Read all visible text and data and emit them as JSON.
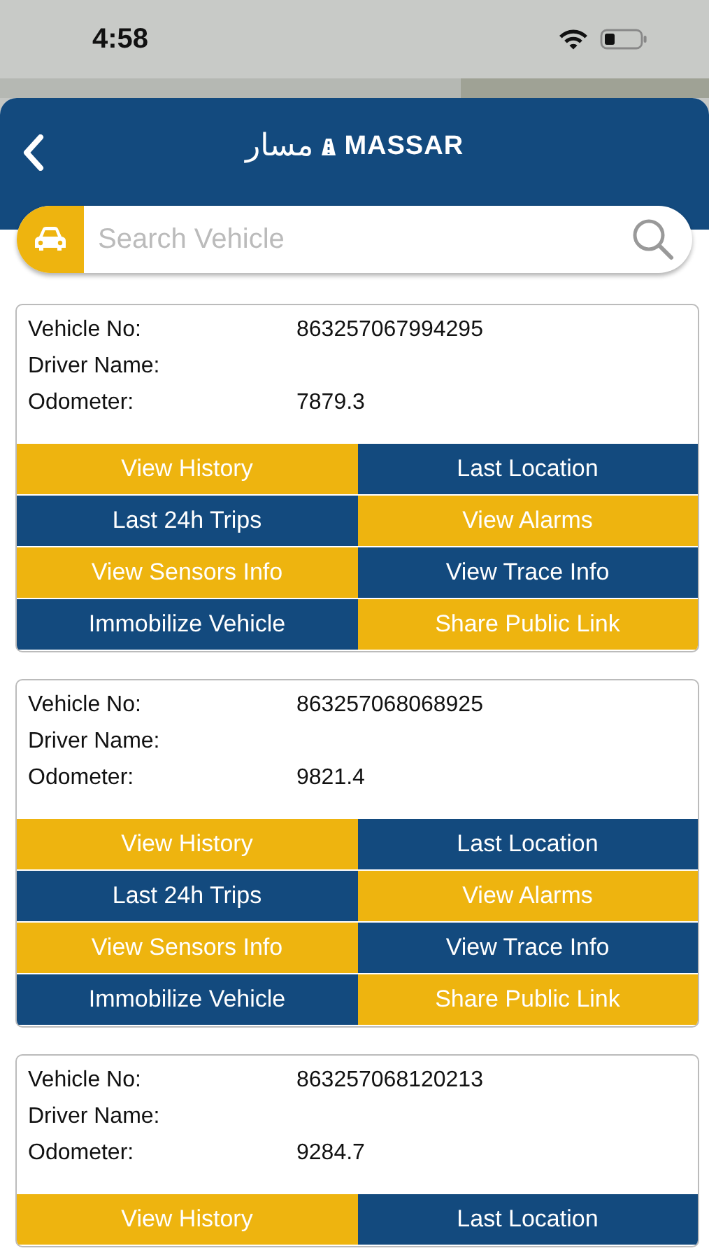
{
  "status_bar": {
    "time": "4:58"
  },
  "header": {
    "logo_arabic": "مسار",
    "logo_text": "MASSAR"
  },
  "search": {
    "placeholder": "Search Vehicle"
  },
  "vehicles": [
    {
      "fields": [
        {
          "label": "Vehicle No:",
          "value": "863257067994295"
        },
        {
          "label": "Driver Name:"
        },
        {
          "label": "Odometer:",
          "value": "7879.3"
        }
      ],
      "actions": [
        {
          "label": "View History",
          "color": "#eeb40f"
        },
        {
          "label": "Last Location",
          "color": "#134a7e"
        },
        {
          "label": "Last 24h Trips",
          "color": "#134a7e"
        },
        {
          "label": "View Alarms",
          "color": "#eeb40f"
        },
        {
          "label": "View Sensors Info",
          "color": "#eeb40f"
        },
        {
          "label": "View Trace Info",
          "color": "#134a7e"
        },
        {
          "label": "Immobilize Vehicle",
          "color": "#134a7e"
        },
        {
          "label": "Share Public Link",
          "color": "#eeb40f"
        }
      ]
    },
    {
      "fields": [
        {
          "label": "Vehicle No:",
          "value": "863257068068925"
        },
        {
          "label": "Driver Name:"
        },
        {
          "label": "Odometer:",
          "value": "9821.4"
        }
      ],
      "actions": [
        {
          "label": "View History",
          "color": "#eeb40f"
        },
        {
          "label": "Last Location",
          "color": "#134a7e"
        },
        {
          "label": "Last 24h Trips",
          "color": "#134a7e"
        },
        {
          "label": "View Alarms",
          "color": "#eeb40f"
        },
        {
          "label": "View Sensors Info",
          "color": "#eeb40f"
        },
        {
          "label": "View Trace Info",
          "color": "#134a7e"
        },
        {
          "label": "Immobilize Vehicle",
          "color": "#134a7e"
        },
        {
          "label": "Share Public Link",
          "color": "#eeb40f"
        }
      ]
    },
    {
      "fields": [
        {
          "label": "Vehicle No:",
          "value": "863257068120213"
        },
        {
          "label": "Driver Name:"
        },
        {
          "label": "Odometer:",
          "value": "9284.7"
        }
      ],
      "actions": [
        {
          "label": "View History",
          "color": "#eeb40f"
        },
        {
          "label": "Last Location",
          "color": "#134a7e"
        }
      ]
    }
  ]
}
